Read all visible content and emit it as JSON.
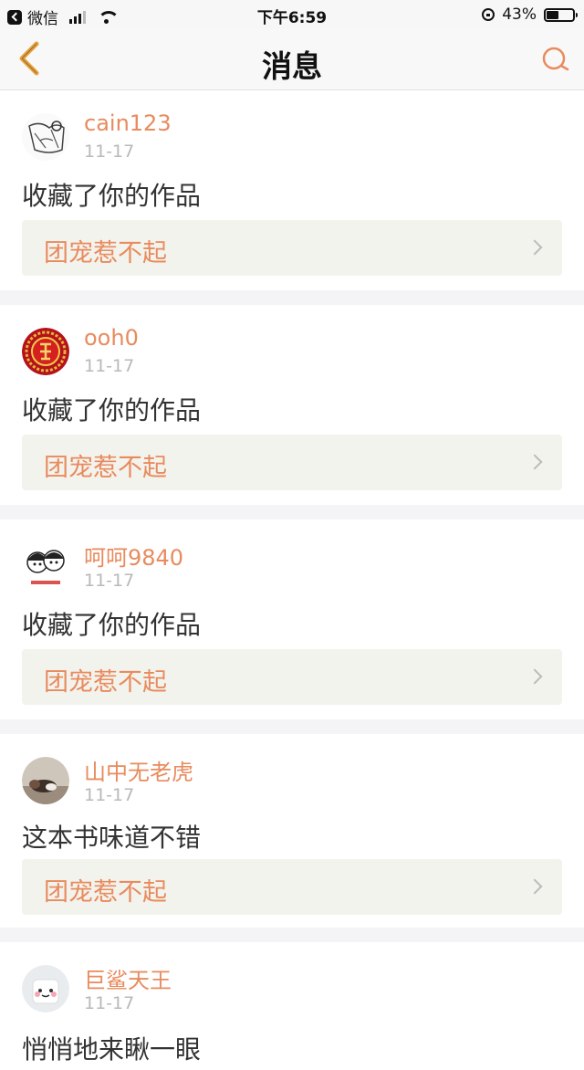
{
  "status_bar": {
    "back_app": "微信",
    "time": "下午6:59",
    "battery_percent": "43%",
    "battery_level": 0.43
  },
  "nav": {
    "title": "消息",
    "back_icon": "chevron-left-icon",
    "search_icon": "search-icon"
  },
  "colors": {
    "accent": "#e88b5e",
    "back_icon": "#e8a23c",
    "card_link_bg": "#f3f3ed"
  },
  "messages": [
    {
      "user": "cain123",
      "date": "11-17",
      "text": "收藏了你的作品",
      "work": "团宠惹不起",
      "avatar": "sketch-avatar"
    },
    {
      "user": "ooh0",
      "date": "11-17",
      "text": "收藏了你的作品",
      "work": "团宠惹不起",
      "avatar": "fu-medallion-avatar"
    },
    {
      "user": "呵呵9840",
      "date": "11-17",
      "text": "收藏了你的作品",
      "work": "团宠惹不起",
      "avatar": "cartoon-couple-avatar"
    },
    {
      "user": "山中无老虎",
      "date": "11-17",
      "text": "这本书味道不错",
      "work": "团宠惹不起",
      "avatar": "sleeping-dog-avatar"
    },
    {
      "user": "巨鲨天王",
      "date": "11-17",
      "text": "悄悄地来瞅一眼",
      "work": "",
      "avatar": "smiley-cup-avatar"
    }
  ]
}
